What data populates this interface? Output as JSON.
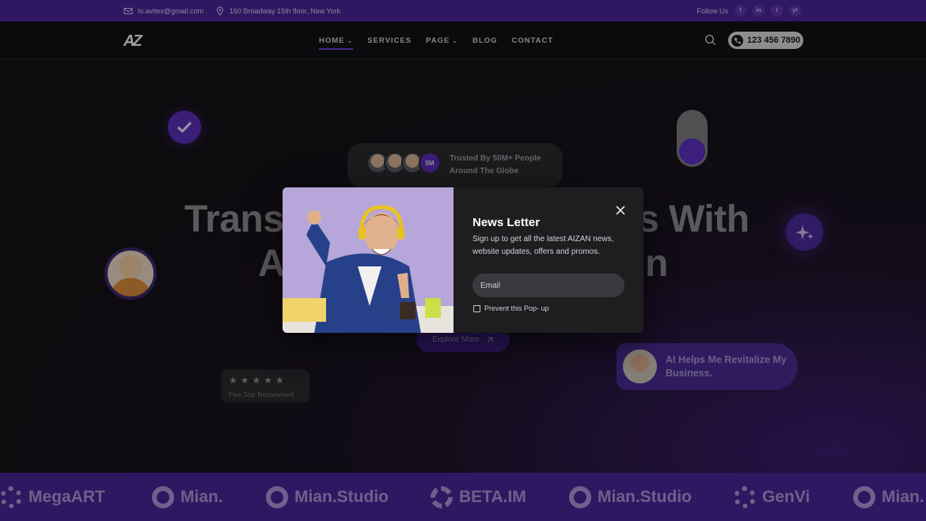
{
  "topbar": {
    "email": "hi.avitex@gmail.com",
    "address": "160 Broadway 15th floor, New York",
    "follow_label": "Follow Us",
    "socials": [
      "f",
      "in",
      "t",
      "yt"
    ]
  },
  "header": {
    "logo": "AZ",
    "nav": [
      "HOME",
      "SERVICES",
      "PAGE",
      "BLOG",
      "CONTACT"
    ],
    "phone": "123 456 7890"
  },
  "hero": {
    "trusted_line1": "Trusted By 50M+ People",
    "trusted_line2": "Around The Globe",
    "trusted_count": "5M",
    "headline_line1_left": "Trans",
    "headline_line1_right": "s With",
    "headline_line2_left": "A",
    "headline_line2_right": "n",
    "explore_label": "Explore More",
    "stars": "★★★★★",
    "stars_label": "Five Star Recomment",
    "review_text_line1": "AI Helps Me Revitalize My",
    "review_text_line2": "Business."
  },
  "brands": [
    "MegaART",
    "Mian.",
    "Mian.Studio",
    "BETA.IM",
    "Mian.Studio",
    "GenVi",
    "Mian."
  ],
  "modal": {
    "title": "News Letter",
    "description": "Sign up to get all the latest AIZAN news, website updates, offers and promos.",
    "email_placeholder": "Email",
    "prevent_label": "Prevent this Pop- up"
  },
  "colors": {
    "accent": "#4a2497",
    "accent_bright": "#5a2fb8",
    "modal_bg": "#1e1d20"
  }
}
